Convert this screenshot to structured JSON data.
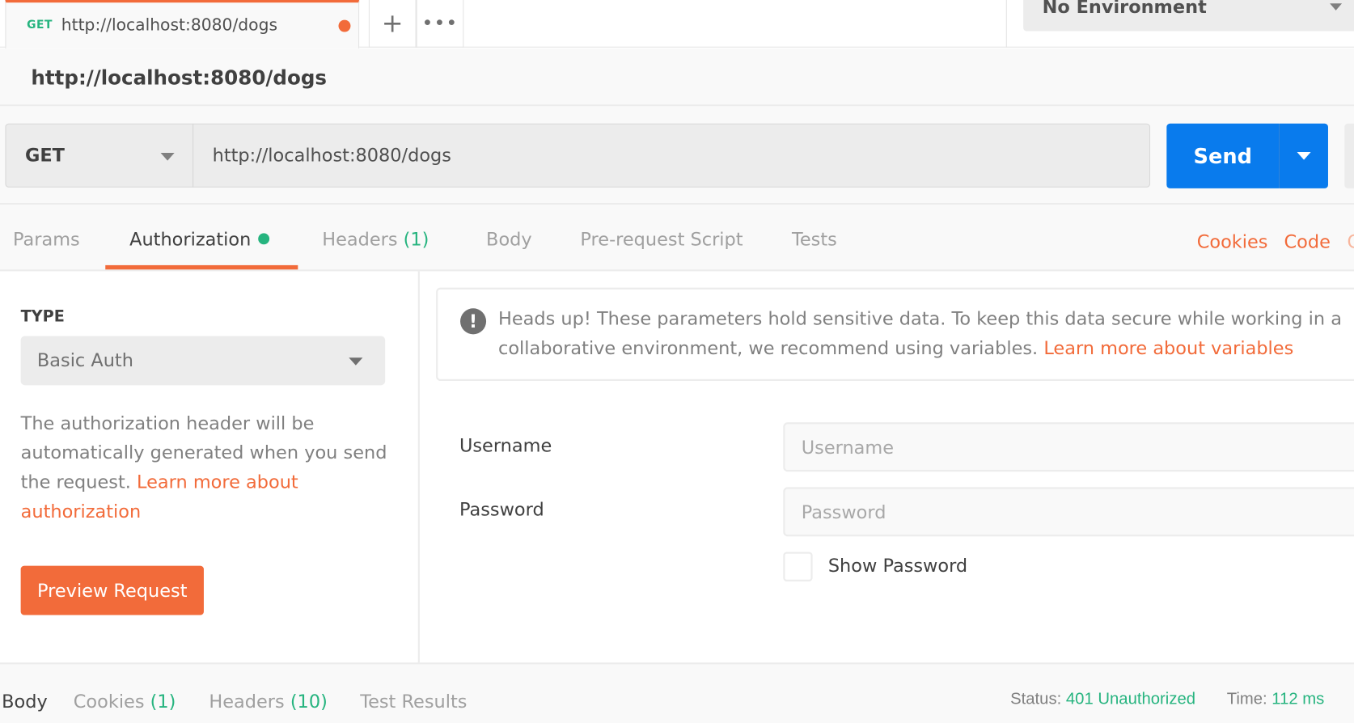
{
  "tab_bar": {
    "active_tab": {
      "method": "GET",
      "title": "http://localhost:8080/dogs",
      "unsaved_indicator": "orange-dot"
    },
    "add_tab_icon": "+",
    "more_tabs_icon": "•••",
    "environment": {
      "selected": "No Environment"
    }
  },
  "request": {
    "name": "http://localhost:8080/dogs",
    "method": "GET",
    "url": "http://localhost:8080/dogs",
    "send_label": "Send"
  },
  "request_tabs": {
    "items": [
      {
        "label": "Params",
        "count": null,
        "active": false
      },
      {
        "label": "Authorization",
        "count": null,
        "active": true
      },
      {
        "label": "Headers",
        "count": "(1)",
        "active": false
      },
      {
        "label": "Body",
        "count": null,
        "active": false
      },
      {
        "label": "Pre-request Script",
        "count": null,
        "active": false
      },
      {
        "label": "Tests",
        "count": null,
        "active": false
      }
    ],
    "links": {
      "cookies": "Cookies",
      "code": "Code",
      "comments_partial": "C"
    }
  },
  "auth": {
    "type_label": "TYPE",
    "type_selected": "Basic Auth",
    "description": "The authorization header will be automatically generated when you send the request.",
    "description_link": "Learn more about authorization",
    "preview_button": "Preview Request",
    "alert": {
      "text": "Heads up! These parameters hold sensitive data. To keep this data secure while working in a collaborative environment, we recommend using variables.",
      "link": "Learn more about variables"
    },
    "username": {
      "label": "Username",
      "value": "",
      "placeholder": "Username"
    },
    "password": {
      "label": "Password",
      "value": "",
      "placeholder": "Password"
    },
    "show_password": {
      "label": "Show Password",
      "checked": false
    }
  },
  "response": {
    "tabs": [
      {
        "label": "Body",
        "count": null,
        "active": true
      },
      {
        "label": "Cookies",
        "count": "(1)",
        "active": false
      },
      {
        "label": "Headers",
        "count": "(10)",
        "active": false
      },
      {
        "label": "Test Results",
        "count": null,
        "active": false
      }
    ],
    "status_label": "Status:",
    "status_value": "401 Unauthorized",
    "time_label": "Time:",
    "time_value": "112 ms"
  },
  "colors": {
    "accent_orange": "#f26b3a",
    "send_blue": "#097bed",
    "success_green": "#26b47f"
  }
}
